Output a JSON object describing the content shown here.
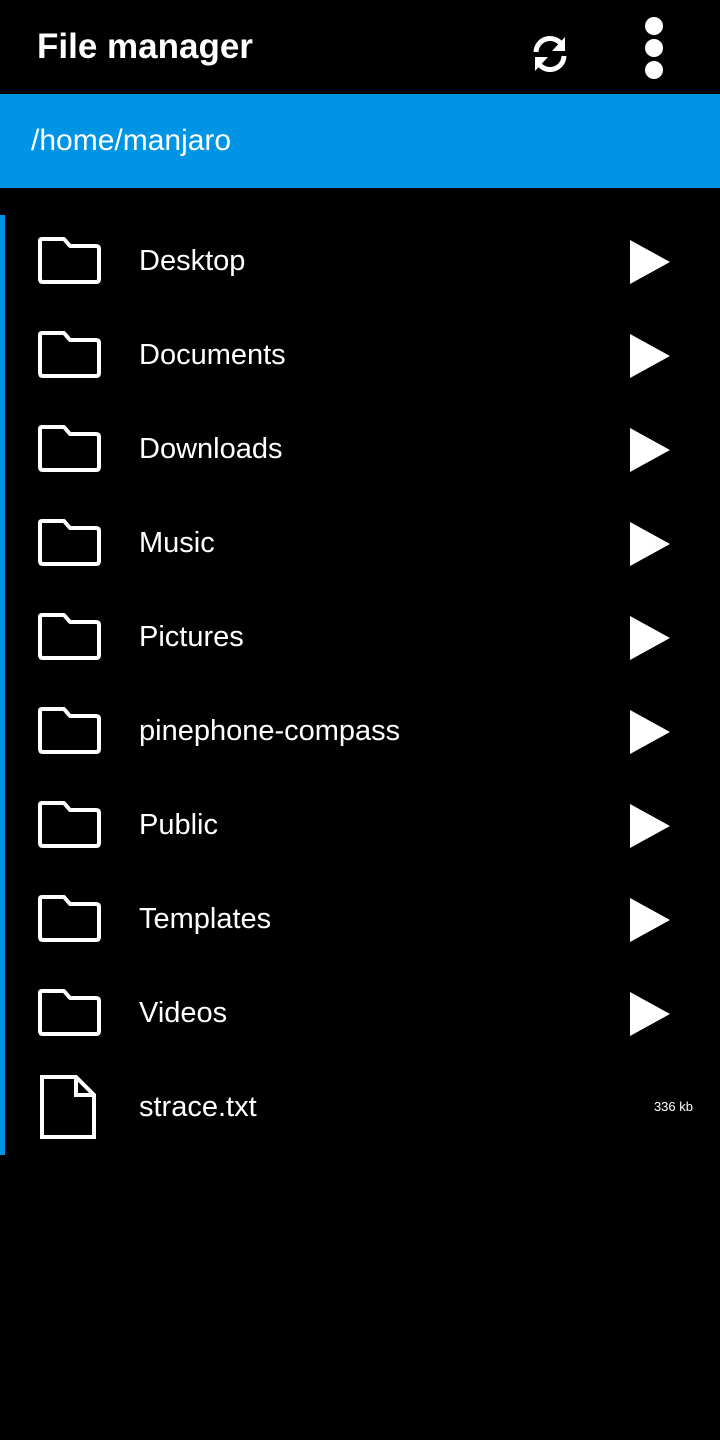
{
  "header": {
    "title": "File manager",
    "refresh_icon": "refresh-icon",
    "menu_icon": "more-vertical-icon"
  },
  "path": {
    "current": "/home/manjaro"
  },
  "colors": {
    "accent": "#0094e4",
    "background": "#000000",
    "text": "#ffffff"
  },
  "entries": [
    {
      "name": "Desktop",
      "type": "folder",
      "icon": "folder-icon",
      "action": "open-arrow-icon"
    },
    {
      "name": "Documents",
      "type": "folder",
      "icon": "folder-icon",
      "action": "open-arrow-icon"
    },
    {
      "name": "Downloads",
      "type": "folder",
      "icon": "folder-icon",
      "action": "open-arrow-icon"
    },
    {
      "name": "Music",
      "type": "folder",
      "icon": "folder-icon",
      "action": "open-arrow-icon"
    },
    {
      "name": "Pictures",
      "type": "folder",
      "icon": "folder-icon",
      "action": "open-arrow-icon"
    },
    {
      "name": "pinephone-compass",
      "type": "folder",
      "icon": "folder-icon",
      "action": "open-arrow-icon"
    },
    {
      "name": "Public",
      "type": "folder",
      "icon": "folder-icon",
      "action": "open-arrow-icon"
    },
    {
      "name": "Templates",
      "type": "folder",
      "icon": "folder-icon",
      "action": "open-arrow-icon"
    },
    {
      "name": "Videos",
      "type": "folder",
      "icon": "folder-icon",
      "action": "open-arrow-icon"
    },
    {
      "name": "strace.txt",
      "type": "file",
      "icon": "file-icon",
      "size": "336 kb"
    }
  ]
}
